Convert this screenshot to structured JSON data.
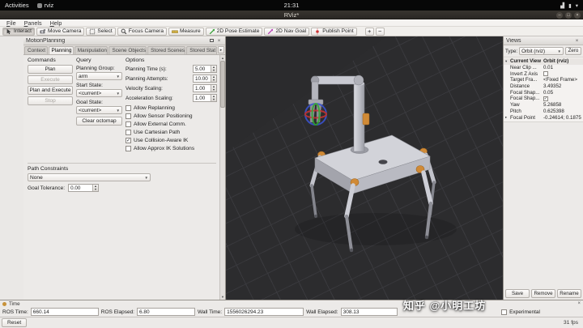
{
  "desktop": {
    "activities": "Activities",
    "app_menu": "rviz",
    "clock": "21:31"
  },
  "window": {
    "title": "RViz*"
  },
  "menu": {
    "items": [
      "File",
      "Panels",
      "Help"
    ]
  },
  "toolbar": {
    "tools": [
      {
        "label": "Interact"
      },
      {
        "label": "Move Camera"
      },
      {
        "label": "Select"
      },
      {
        "label": "Focus Camera"
      },
      {
        "label": "Measure"
      },
      {
        "label": "2D Pose Estimate"
      },
      {
        "label": "2D Nav Goal"
      },
      {
        "label": "Publish Point"
      }
    ],
    "add_button": "+",
    "remove_button": "−"
  },
  "motion_planning": {
    "title": "MotionPlanning",
    "tabs": [
      "Context",
      "Planning",
      "Manipulation",
      "Scene Objects",
      "Stored Scenes",
      "Stored Stat"
    ],
    "commands": {
      "title": "Commands",
      "plan": "Plan",
      "execute": "Execute",
      "plan_and_execute": "Plan and Execute",
      "stop": "Stop"
    },
    "query": {
      "title": "Query",
      "planning_group_label": "Planning Group:",
      "planning_group": "arm",
      "start_state_label": "Start State:",
      "start_state": "<current>",
      "goal_state_label": "Goal State:",
      "goal_state": "<current>",
      "clear_octomap": "Clear octomap"
    },
    "options": {
      "title": "Options",
      "fields": [
        {
          "label": "Planning Time (s):",
          "value": "5.00"
        },
        {
          "label": "Planning Attempts:",
          "value": "10.00"
        },
        {
          "label": "Velocity Scaling:",
          "value": "1.00"
        },
        {
          "label": "Acceleration Scaling:",
          "value": "1.00"
        }
      ],
      "checkboxes": [
        {
          "label": "Allow Replanning",
          "cls": "cb"
        },
        {
          "label": "Allow Sensor Positioning",
          "cls": "cb"
        },
        {
          "label": "Allow External Comm.",
          "cls": "cb"
        },
        {
          "label": "Use Cartesian Path",
          "cls": "cb"
        },
        {
          "label": "Use Collision-Aware IK",
          "cls": "cb on"
        },
        {
          "label": "Allow Approx IK Solutions",
          "cls": "cb"
        }
      ]
    },
    "path_constraints": {
      "title": "Path Constraints",
      "value": "None",
      "goal_tolerance_label": "Goal Tolerance:",
      "goal_tolerance": "0.00"
    }
  },
  "views": {
    "title": "Views",
    "type_label": "Type:",
    "type_value": "Orbit (rviz)",
    "zero_button": "Zero",
    "properties": [
      {
        "arrow": "▾",
        "name": "Current View",
        "value": "Orbit (rviz)"
      },
      {
        "name": "Near Clip ...",
        "value": "0.01"
      },
      {
        "name": "Invert Z Axis",
        "value": "",
        "cls": "vcb"
      },
      {
        "name": "Target Fra...",
        "value": "<Fixed Frame>"
      },
      {
        "name": "Distance",
        "value": "3.49352"
      },
      {
        "name": "Focal Shap...",
        "value": "0.05"
      },
      {
        "name": "Focal Shap...",
        "value": "",
        "cls": "vcb on"
      },
      {
        "name": "Yaw",
        "value": "5.26858"
      },
      {
        "name": "Pitch",
        "value": "0.625398"
      },
      {
        "arrow": "▸",
        "name": "Focal Point",
        "value": "-0.24614; 0.1875..."
      }
    ],
    "save": "Save",
    "remove": "Remove",
    "rename": "Rename"
  },
  "time_panel": {
    "title": "Time",
    "ros_time_label": "ROS Time:",
    "ros_time": "660.14",
    "ros_elapsed_label": "ROS Elapsed:",
    "ros_elapsed": "6.80",
    "wall_time_label": "Wall Time:",
    "wall_time": "1556026294.23",
    "wall_elapsed_label": "Wall Elapsed:",
    "wall_elapsed": "308.13",
    "experimental": "Experimental"
  },
  "status": {
    "reset": "Reset",
    "fps": "31 fps"
  },
  "watermark": "知乎 @小明工坊",
  "colors": {
    "viewport_bg": "#2c2c2e",
    "grid_line": "#3a3a3e",
    "joint_orange": "#d08a36"
  }
}
